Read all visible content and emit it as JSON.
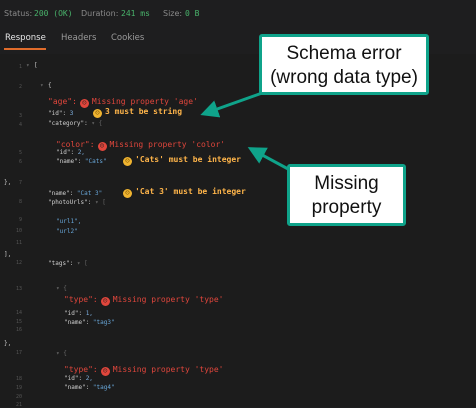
{
  "status": {
    "status_label": "Status:",
    "status_value": "200 (OK)",
    "duration_label": "Duration:",
    "duration_value": "241 ms",
    "size_label": "Size:",
    "size_value": "0 B"
  },
  "tabs": [
    {
      "label": "Response",
      "active": true
    },
    {
      "label": "Headers",
      "active": false
    },
    {
      "label": "Cookies",
      "active": false
    }
  ],
  "line_numbers": [
    "1",
    "2",
    "3",
    "4",
    "5",
    "6",
    "7",
    "8",
    "9",
    "10",
    "11",
    "12",
    "13",
    "14",
    "15",
    "16",
    "17",
    "18",
    "19",
    "20",
    "21"
  ],
  "code": {
    "open_bracket": "[",
    "open_brace": "{",
    "age_key": "\"age\":",
    "age_error": "Missing property 'age'",
    "id_key": "\"id\":",
    "id_value": "3",
    "id_warning": "3 must be string",
    "category_key": "\"category\":",
    "color_key": "\"color\":",
    "color_error": "Missing property 'color'",
    "cat_id_key": "\"id\":",
    "cat_id_value": "2,",
    "cat_name_key": "\"name\":",
    "cat_name_value": "\"Cats\"",
    "cat_name_warning": "'Cats' must be integer",
    "close_brace_comma": "},",
    "name_key": "\"name\":",
    "name_value": "\"Cat 3\"",
    "name_warning": "'Cat 3' must be integer",
    "photo_key": "\"photoUrls\":",
    "url1": "\"url1\",",
    "url2": "\"url2\"",
    "close_bracket_comma": "],",
    "tags_key": "\"tags\":",
    "type_key": "\"type\":",
    "type_error": "Missing property 'type'",
    "tag1_id_value": "1,",
    "tag1_name_value": "\"tag3\"",
    "tag2_id_value": "2,",
    "tag2_name_value": "\"tag4\""
  },
  "callouts": {
    "schema_error": "Schema error\n(wrong data type)",
    "missing_property": "Missing\nproperty"
  },
  "icons": {
    "error_icon": "error-face-icon",
    "warning_icon": "warning-face-icon"
  },
  "colors": {
    "accent": "#e06c2b",
    "callout_border": "#0fa38a",
    "error": "#e0463c",
    "warning": "#ffb54a",
    "status_ok": "#49b36b"
  }
}
